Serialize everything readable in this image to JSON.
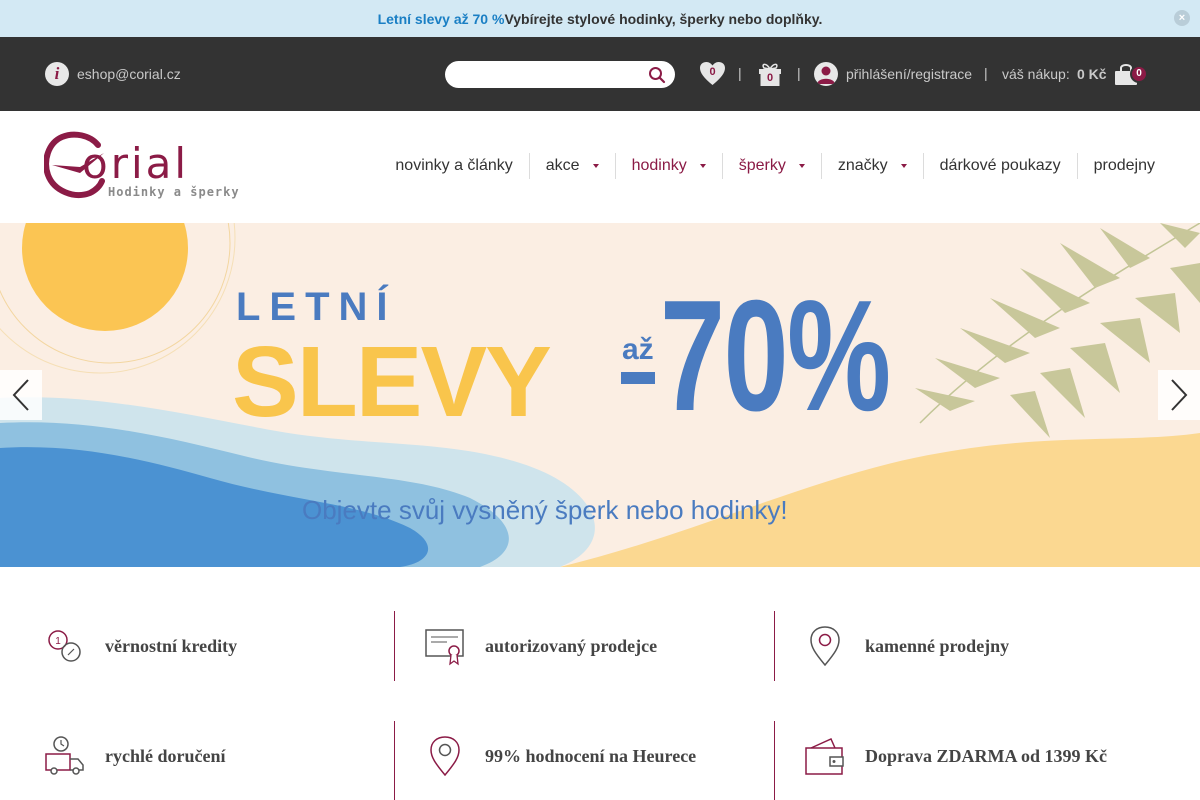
{
  "promo": {
    "lead_glyph": "",
    "highlight": "Letní slevy až 70 %",
    "mid_glyph": "",
    "rest": " Vybírejte stylové hodinky, šperky nebo doplňky.",
    "close": "×"
  },
  "topbar": {
    "info_glyph": "i",
    "email": "eshop@corial.cz",
    "search_placeholder": "",
    "wishlist_count": "0",
    "gift_count": "0",
    "separator": "|",
    "login": "přihlášení/registrace",
    "cart_label": "váš nákup:",
    "cart_total": "0 Kč",
    "cart_count": "0"
  },
  "logo": {
    "word": "orial",
    "tagline": "Hodinky a šperky"
  },
  "nav": [
    {
      "label": "novinky a články"
    },
    {
      "label": "akce"
    },
    {
      "label": "hodinky"
    },
    {
      "label": "šperky"
    },
    {
      "label": "značky"
    },
    {
      "label": "dárkové poukazy"
    },
    {
      "label": "prodejny"
    }
  ],
  "banner": {
    "line1": "LETNÍ",
    "line2": "SLEVY",
    "prefix": "až",
    "percent": "70%",
    "subtitle": "Objevte svůj vysněný šperk nebo hodinky!"
  },
  "benefits": [
    {
      "label": "věrnostní kredity",
      "icon": "coins-icon"
    },
    {
      "label": "autorizovaný prodejce",
      "icon": "certificate-icon"
    },
    {
      "label": "kamenné prodejny",
      "icon": "location-pin-icon"
    },
    {
      "label": "rychlé doručení",
      "icon": "delivery-truck-icon"
    },
    {
      "label": "99% hodnocení na Heurece",
      "icon": "rating-pin-icon"
    },
    {
      "label": "Doprava ZDARMA od 1399 Kč",
      "icon": "wallet-icon"
    }
  ],
  "colors": {
    "brand": "#8b1b46",
    "topbar": "#333333",
    "promo_bg": "#d3e9f4",
    "banner_blue": "#4a7bc0",
    "banner_yellow": "#f9c54c"
  }
}
